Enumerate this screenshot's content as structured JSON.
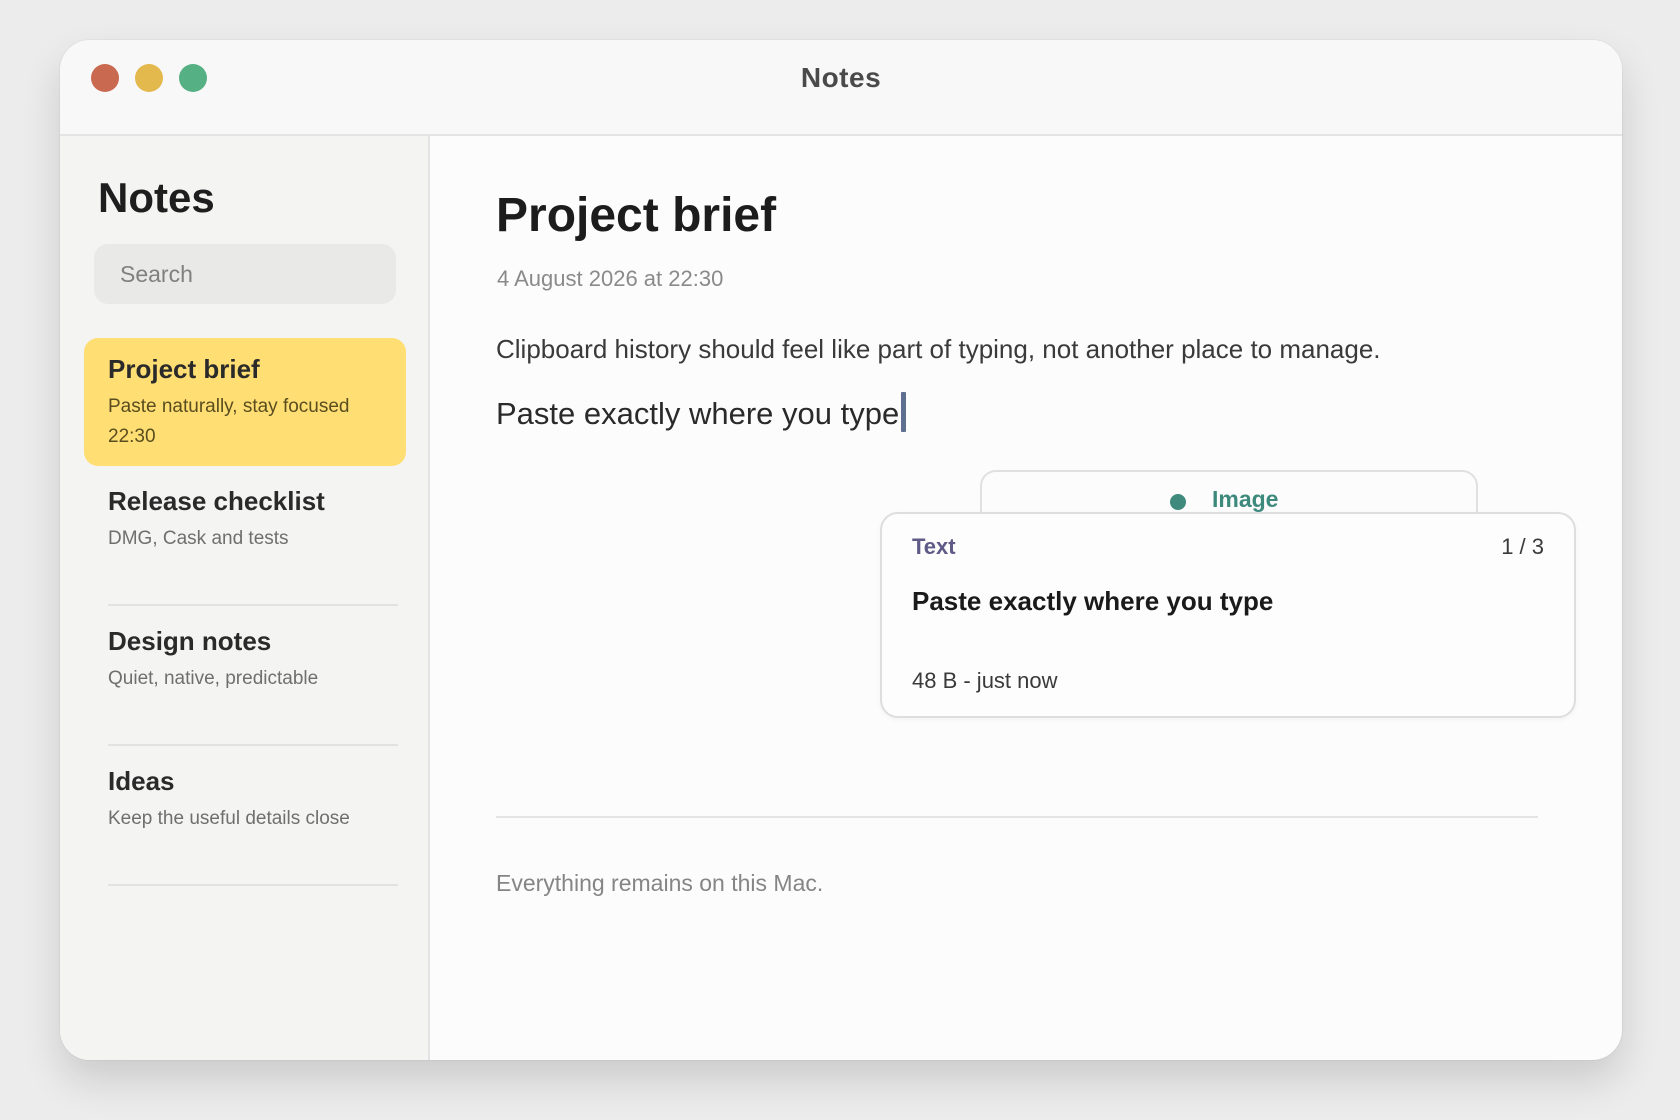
{
  "window": {
    "title": "Notes"
  },
  "sidebar": {
    "title": "Notes",
    "search_placeholder": "Search",
    "notes": [
      {
        "title": "Project brief",
        "subtitle": "Paste naturally, stay focused",
        "time": "22:30",
        "selected": true
      },
      {
        "title": "Release checklist",
        "subtitle": "DMG, Cask and tests"
      },
      {
        "title": "Design notes",
        "subtitle": "Quiet, native, predictable"
      },
      {
        "title": "Ideas",
        "subtitle": "Keep the useful details close"
      }
    ]
  },
  "document": {
    "title": "Project brief",
    "date": "4 August 2026 at 22:30",
    "paragraph": "Clipboard history should feel like part of typing, not another place to manage.",
    "typing_line": "Paste exactly where you type",
    "footer": "Everything remains on this Mac."
  },
  "clipboard_popup": {
    "back_card_label": "Image",
    "front_card": {
      "type": "Text",
      "position": "1 / 3",
      "content": "Paste exactly where you type",
      "meta": "48 B - just now"
    }
  },
  "colors": {
    "accent_selected": "#ffde73",
    "image_label": "#3d8a7d",
    "text_label": "#5f5a86",
    "traffic_red": "#c9694f",
    "traffic_yellow": "#e3b84d",
    "traffic_green": "#55b083"
  }
}
